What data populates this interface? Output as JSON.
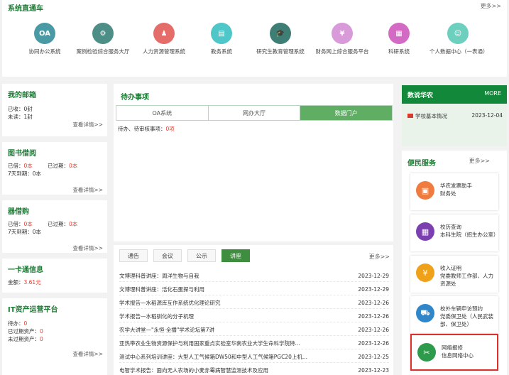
{
  "systems": {
    "title": "系统直通车",
    "more": "更多>>",
    "items": [
      {
        "icon": "OA",
        "label": "协同办公系统",
        "color": "#4a9aa6"
      },
      {
        "icon": "⚙",
        "label": "案例检验综合服务大厅",
        "color": "#4d8f87"
      },
      {
        "icon": "♟",
        "label": "人力资源管理系统",
        "color": "#e46d6a"
      },
      {
        "icon": "▤",
        "label": "教务系统",
        "color": "#4fc6c7"
      },
      {
        "icon": "🎓",
        "label": "研究生教育管理系统",
        "color": "#3e7e74"
      },
      {
        "icon": "¥",
        "label": "财务网上综合服务平台",
        "color": "#d89ad8"
      },
      {
        "icon": "▦",
        "label": "科研系统",
        "color": "#d36ac3"
      },
      {
        "icon": "☺",
        "label": "个人数据中心（一表通）",
        "color": "#6dcfbe"
      }
    ]
  },
  "mail": {
    "title": "我的邮箱",
    "received": "已收：",
    "received_val": "0封",
    "unread": "未读：",
    "unread_val": "1封",
    "detail": "查看详情>>"
  },
  "library": {
    "title": "图书借阅",
    "borrowed": "已借：",
    "borrowed_val": "0本",
    "overdue": "已过期：",
    "overdue_val": "0本",
    "due": "7天到期：",
    "due_val": "0本",
    "detail": "查看详情>>"
  },
  "appliance": {
    "title": "器借购",
    "borrowed": "已借：",
    "borrowed_val": "0本",
    "overdue": "已过期：",
    "overdue_val": "0本",
    "due": "7天到期：",
    "due_val": "0本",
    "detail": "查看详情>>"
  },
  "card": {
    "title": "一卡通信息",
    "balance": "金额：",
    "balance_val": "3.61元"
  },
  "assets": {
    "title": "IT资产运营平台",
    "pending": "待办：",
    "pending_val": "0",
    "done": "已过期资产：",
    "done_val": "0",
    "notdone": "未过期资产：",
    "notdone_val": "0",
    "detail": "查看详情>>"
  },
  "todo": {
    "title": "待办事项",
    "tabs": [
      "OA系统",
      "网办大厅",
      "数据门户"
    ],
    "status": "待办、待审核事项：",
    "status_val": "0项"
  },
  "news": {
    "tabs": [
      "通告",
      "会议",
      "公示",
      "讲座"
    ],
    "more": "更多>>",
    "rows": [
      {
        "title": "文博理科普讲座：周洋生物与自我",
        "date": "2023-12-29"
      },
      {
        "title": "文博理科普讲座：活化石蛋探与利用",
        "date": "2023-12-29"
      },
      {
        "title": "学术报告—水稻源库互作系统优化理论研究",
        "date": "2023-12-26"
      },
      {
        "title": "学术报告—水稻驯化的分子机理",
        "date": "2023-12-26"
      },
      {
        "title": "农学大讲堂—\"永恒·全播\"学术论坛第7讲",
        "date": "2023-12-26"
      },
      {
        "title": "亚热带农业生物资源保护与利用国家重点实验室华南农业大学生命科学院特...",
        "date": "2023-12-26"
      },
      {
        "title": "测试中心系列培训讲座：大型人工气候箱DW50和中型人工气候箱PGC20上机...",
        "date": "2023-12-25"
      },
      {
        "title": "电智学术报告：面向无人农场的小麦赤霉病智慧监测技术及应用",
        "date": "2023-12-23"
      }
    ]
  },
  "campus": {
    "title": "数说华农",
    "more": "MORE",
    "item": "学校基本情况",
    "date": "2023-12-04"
  },
  "services": {
    "title": "便民服务",
    "more": "更多>>",
    "items": [
      {
        "icon": "▣",
        "line1": "华农发票助手",
        "line2": "财务处",
        "color": "#ef7b3f"
      },
      {
        "icon": "▦",
        "line1": "校历查询",
        "line2": "本科生院（招生办公室）",
        "color": "#7b3fb0"
      },
      {
        "icon": "¥",
        "line1": "收入证明",
        "line2": "党委教师工作部、人力资源处",
        "color": "#f0a11a"
      },
      {
        "icon": "⛟",
        "line1": "校外车辆申访预约",
        "line2": "党委保卫处（人民武装部、保卫处）",
        "color": "#2f86c9"
      },
      {
        "icon": "✂",
        "line1": "网络报修",
        "line2": "信息网络中心",
        "color": "#2e9b4c"
      }
    ]
  }
}
